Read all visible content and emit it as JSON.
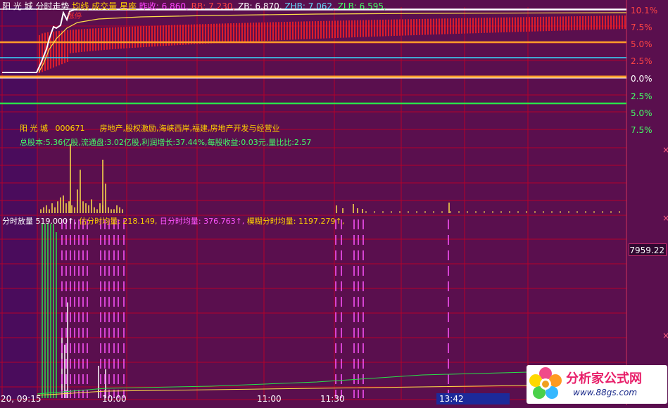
{
  "stock": {
    "name": "阳 光 城",
    "code": "000671",
    "chart_title": "分时走势",
    "tags": "房地产,股权激励,海峡西岸,福建,房地产开发与经营业",
    "info": "总股本:5.36亿股,流通盘:3.02亿股,利润增长:37.44%,每股收益:0.03元,量比比:2.57"
  },
  "header_items": [
    {
      "text": "均线",
      "color": "#ffd200"
    },
    {
      "text": "成交量",
      "color": "#ffd200"
    },
    {
      "text": "星座",
      "color": "#ffd200"
    },
    {
      "text": "昨收: 6.860,",
      "color": "#ff44ff"
    },
    {
      "text": "RB: 7.230,",
      "color": "#ff4444"
    },
    {
      "text": "ZB: 6.870,",
      "color": "#ffffff"
    },
    {
      "text": "ZHB: 7.062,",
      "color": "#66ddff"
    },
    {
      "text": "ZLB: 6.595,",
      "color": "#44ff66"
    }
  ],
  "annotation": {
    "text": "涨停"
  },
  "right_axis": [
    "10.1%",
    "7.5%",
    "5.0%",
    "2.5%",
    "0.0%",
    "2.5%",
    "5.0%",
    "7.5%"
  ],
  "volume": {
    "label": "分时放量",
    "value": "519.000↑,",
    "est_avg": "估分时均量: 218.149,",
    "day_avg": "日分时均量: 376.763↑,",
    "fuzzy_avg": "模糊分时均量: 1197.279↑,",
    "right_value": "7959.22"
  },
  "time_axis": {
    "ticks": [
      "20, 09:15",
      "10:00",
      "11:00",
      "11:30"
    ],
    "current": "13:42"
  },
  "watermark": {
    "title": "分析家公式网",
    "url": "www.88gs.com"
  },
  "colors": {
    "bg": "#5a0f4e",
    "grid": "#b4002a",
    "price": "#ffffff",
    "avg": "#ffe04a",
    "red_bars": "#e8202a",
    "cyan": "#38d8ff",
    "orange": "#ff9c2a",
    "green": "#2ae04a",
    "magenta": "#ff55ff"
  },
  "chart_data": [
    {
      "type": "line",
      "name_series": "price",
      "x_unit": "minute index",
      "y_unit": "percent change",
      "ylim": [
        -7.5,
        10.1
      ],
      "x": [
        0,
        10,
        20,
        25,
        30,
        35,
        38,
        42,
        45,
        48,
        50,
        52,
        55,
        60,
        75,
        90,
        100,
        200,
        260
      ],
      "y": [
        0,
        0,
        0,
        2,
        4,
        6,
        8,
        10.1,
        8.5,
        9.5,
        10.1,
        10.1,
        10.1,
        10.1,
        10.1,
        10.1,
        10.1,
        10.1,
        10.1
      ]
    },
    {
      "type": "line",
      "name_series": "average",
      "x": [
        25,
        30,
        40,
        50,
        60,
        80,
        100,
        150,
        200,
        260
      ],
      "y": [
        0,
        1,
        5,
        8,
        9,
        9.4,
        9.6,
        9.8,
        9.85,
        9.9
      ]
    },
    {
      "type": "bar",
      "name_series": "volume",
      "values": [
        2,
        3,
        4,
        2,
        5,
        3,
        6,
        8,
        9,
        5,
        6,
        4,
        3,
        12,
        22,
        6,
        5,
        4,
        7,
        3,
        2,
        5,
        4,
        15,
        3,
        2,
        2,
        4,
        3,
        2
      ]
    }
  ]
}
